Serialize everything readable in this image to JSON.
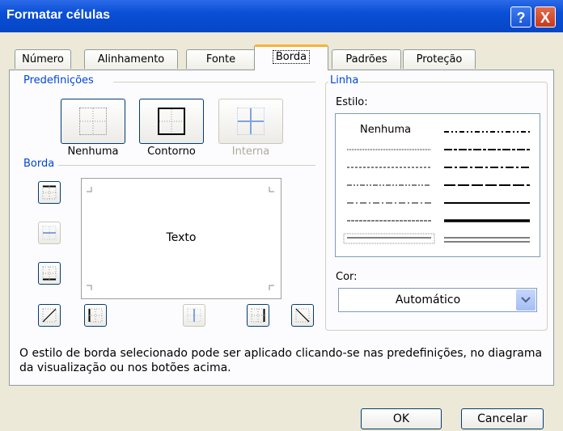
{
  "window": {
    "title": "Formatar células"
  },
  "titlebar_buttons": {
    "help": "?",
    "close": "X"
  },
  "tabs": [
    {
      "label": "Número"
    },
    {
      "label": "Alinhamento"
    },
    {
      "label": "Fonte"
    },
    {
      "label": "Borda",
      "active": true
    },
    {
      "label": "Padrões"
    },
    {
      "label": "Proteção"
    }
  ],
  "predefinicoes": {
    "title": "Predefinições",
    "items": [
      {
        "label": "Nenhuma",
        "enabled": true
      },
      {
        "label": "Contorno",
        "enabled": true
      },
      {
        "label": "Interna",
        "enabled": false
      }
    ]
  },
  "borda": {
    "title": "Borda",
    "preview_text": "Texto"
  },
  "linha": {
    "title": "Linha",
    "estilo_label": "Estilo:",
    "none_label": "Nenhuma",
    "cor_label": "Cor:",
    "cor_value": "Automático"
  },
  "description": "O estilo de borda selecionado pode ser aplicado clicando-se nas predefinições, no diagrama da visualização ou nos botões acima.",
  "buttons": {
    "ok": "OK",
    "cancel": "Cancelar"
  },
  "colors": {
    "accent": "#0046d5",
    "titlebar": "#0a4fd6",
    "tab_highlight": "#f9b233"
  }
}
